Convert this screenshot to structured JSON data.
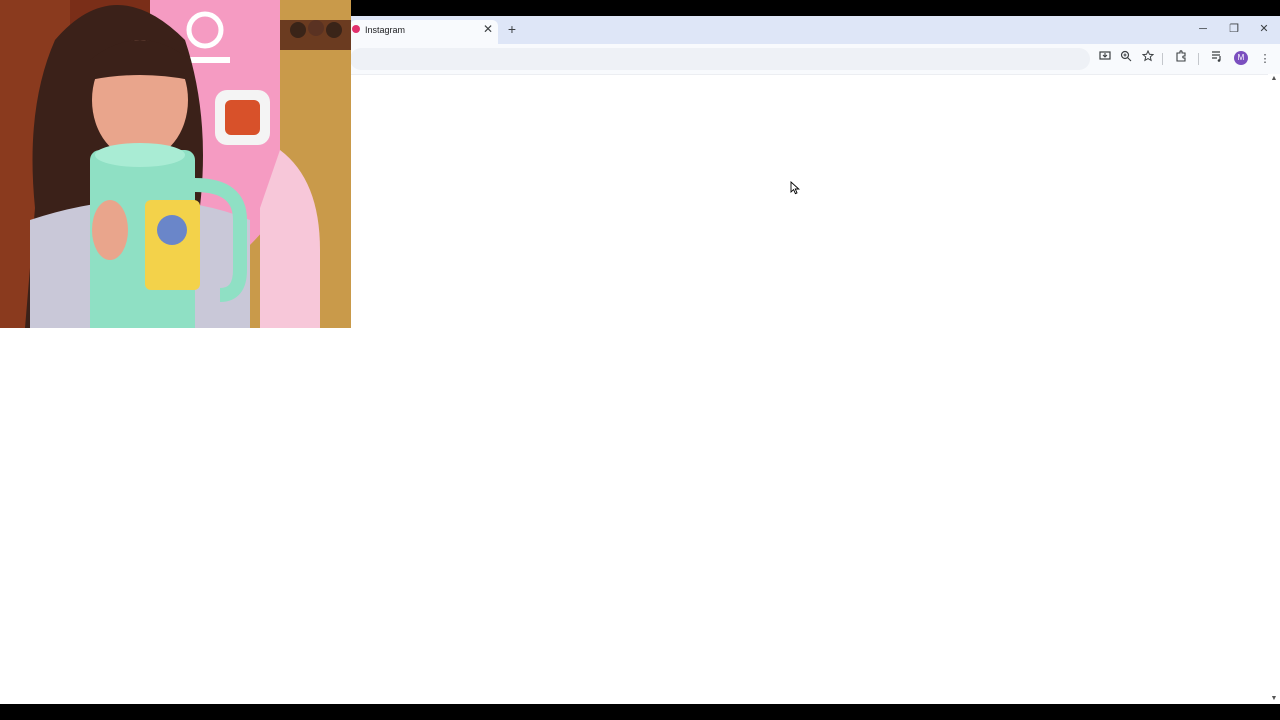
{
  "browser": {
    "tab": {
      "title": "Instagram",
      "close_glyph": "✕",
      "favicon": "instagram-icon"
    },
    "new_tab_glyph": "+",
    "window_controls": {
      "minimize": "─",
      "restore": "❐",
      "close": "✕"
    },
    "toolbar": {
      "icons": [
        "install-app-icon",
        "zoom-icon",
        "bookmark-star-icon",
        "extensions-icon",
        "media-controls-icon",
        "profile-avatar",
        "menu-icon"
      ],
      "avatar_letter": "M",
      "menu_glyph": "⋮"
    }
  },
  "webcam_overlay": {
    "description_icon": "webcam-feed"
  },
  "colors": {
    "tabstrip": "#dee6f7",
    "toolbar": "#f8fafd",
    "avatar": "#7b4fbf",
    "favicon": "#e1306c"
  }
}
